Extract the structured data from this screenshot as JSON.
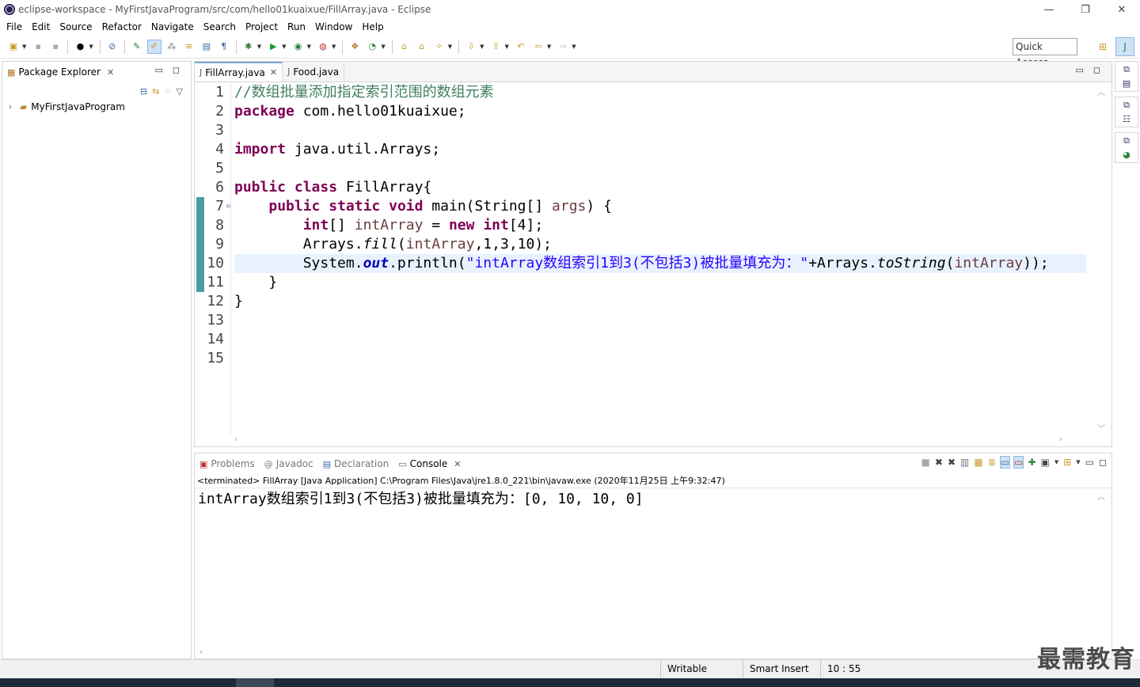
{
  "window": {
    "title": "eclipse-workspace - MyFirstJavaProgram/src/com/hello01kuaixue/FillArray.java - Eclipse",
    "minimize": "—",
    "restore": "❐",
    "close": "✕"
  },
  "menu": [
    "File",
    "Edit",
    "Source",
    "Refactor",
    "Navigate",
    "Search",
    "Project",
    "Run",
    "Window",
    "Help"
  ],
  "toolbar": {
    "quick_access": "Quick Access"
  },
  "package_explorer": {
    "title": "Package Explorer",
    "tree": [
      {
        "label": "MyFirstJavaProgram",
        "expanded": false
      }
    ]
  },
  "editor": {
    "tabs": [
      {
        "label": "FillArray.java",
        "active": true
      },
      {
        "label": "Food.java",
        "active": false
      }
    ],
    "line_numbers": [
      "1",
      "2",
      "3",
      "4",
      "5",
      "6",
      "7",
      "8",
      "9",
      "10",
      "11",
      "12",
      "13",
      "14",
      "15"
    ],
    "lines": {
      "l1_comment": "//数组批量添加指定索引范围的数组元素",
      "l2_kw": "package",
      "l2_rest": " com.hello01kuaixue;",
      "l4_kw": "import",
      "l4_rest": " java.util.Arrays;",
      "l6_kw1": "public",
      "l6_kw2": "class",
      "l6_rest": " FillArray{",
      "l7_indent": "    ",
      "l7_kw1": "public",
      "l7_kw2": "static",
      "l7_kw3": "void",
      "l7_mid": " main(String[] ",
      "l7_var": "args",
      "l7_end": ") {",
      "l8_indent": "        ",
      "l8_kw1": "int",
      "l8_mid1": "[] ",
      "l8_var": "intArray",
      "l8_mid2": " = ",
      "l8_kw2": "new",
      "l8_sp": " ",
      "l8_kw3": "int",
      "l8_end": "[4];",
      "l9_indent": "        ",
      "l9_a": "Arrays.",
      "l9_method": "fill",
      "l9_b": "(",
      "l9_var": "intArray",
      "l9_end": ",1,3,10);",
      "l10_indent": "        ",
      "l10_a": "System.",
      "l10_field": "out",
      "l10_b": ".println(",
      "l10_str": "\"intArray数组索引1到3(不包括3)被批量填充为：\"",
      "l10_c": "+Arrays.",
      "l10_method": "toString",
      "l10_d": "(",
      "l10_var": "intArray",
      "l10_end": "));",
      "l11": "    }",
      "l12": "}"
    }
  },
  "console": {
    "tabs": [
      {
        "label": "Problems",
        "active": false
      },
      {
        "label": "Javadoc",
        "active": false
      },
      {
        "label": "Declaration",
        "active": false
      },
      {
        "label": "Console",
        "active": true
      }
    ],
    "status": "<terminated> FillArray [Java Application] C:\\Program Files\\Java\\jre1.8.0_221\\bin\\javaw.exe (2020年11月25日 上午9:32:47)",
    "output": "intArray数组索引1到3(不包括3)被批量填充为：[0, 10, 10, 0]"
  },
  "statusbar": {
    "writable": "Writable",
    "insert_mode": "Smart Insert",
    "position": "10 : 55"
  },
  "watermark": "最需教育",
  "colors": {
    "keyword": "#7f0055",
    "comment": "#3f7f5f",
    "string": "#2a00ff",
    "field": "#0000c0",
    "current_line": "#e8f2fe"
  }
}
